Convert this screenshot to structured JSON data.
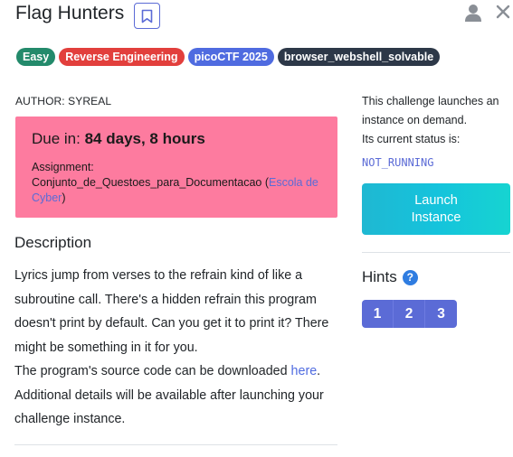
{
  "challenge": {
    "title": "Flag Hunters",
    "tags": [
      {
        "label": "Easy",
        "color": "#238a6b"
      },
      {
        "label": "Reverse Engineering",
        "color": "#e23f3c"
      },
      {
        "label": "picoCTF 2025",
        "color": "#4f6be0"
      },
      {
        "label": "browser_webshell_solvable",
        "color": "#2d3848"
      }
    ],
    "author": "AUTHOR: SYREAL"
  },
  "due": {
    "prefix": "Due in: ",
    "value": "84 days, 8 hours",
    "assignment_label": "Assignment:",
    "assignment_name": "Conjunto_de_Questoes_para_Documentacao (",
    "school_link": "Escola de Cyber",
    "assignment_close": ")"
  },
  "description": {
    "heading": "Description",
    "text_before_link": "Lyrics jump from verses to the refrain kind of like a subroutine call. There's a hidden refrain this program doesn't print by default. Can you get it to print it? There might be something in it for you.",
    "download_prefix": "The program's source code can be downloaded ",
    "download_link": "here",
    "download_suffix": ".",
    "additional": "Additional details will be available after launching your challenge instance."
  },
  "instance": {
    "info": "This challenge launches an instance on demand.",
    "status_label": "Its current status is:",
    "status": "NOT_RUNNING",
    "launch_line1": "Launch",
    "launch_line2": "Instance"
  },
  "hints": {
    "heading": "Hints",
    "help_symbol": "?",
    "items": [
      "1",
      "2",
      "3"
    ]
  },
  "icons": {
    "bookmark": "bookmark-icon",
    "user": "user-icon",
    "close": "close-icon",
    "help": "question-circle-icon"
  }
}
